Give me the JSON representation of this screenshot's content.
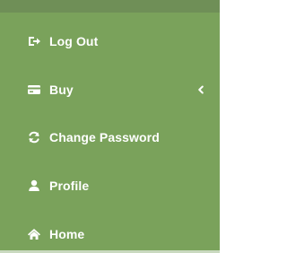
{
  "menu": {
    "items": [
      {
        "label": "Log Out",
        "icon": "sign-out-icon"
      },
      {
        "label": "Buy",
        "icon": "credit-card-icon",
        "has_chevron": true,
        "chevron_icon": "chevron-left-icon"
      },
      {
        "label": "Change Password",
        "icon": "refresh-icon"
      },
      {
        "label": "Profile",
        "icon": "user-icon"
      },
      {
        "label": "Home",
        "icon": "home-icon"
      }
    ]
  },
  "colors": {
    "sidebar_bg": "#7aa25b",
    "top_strip": "#6f8f57",
    "text": "#ffffff"
  }
}
